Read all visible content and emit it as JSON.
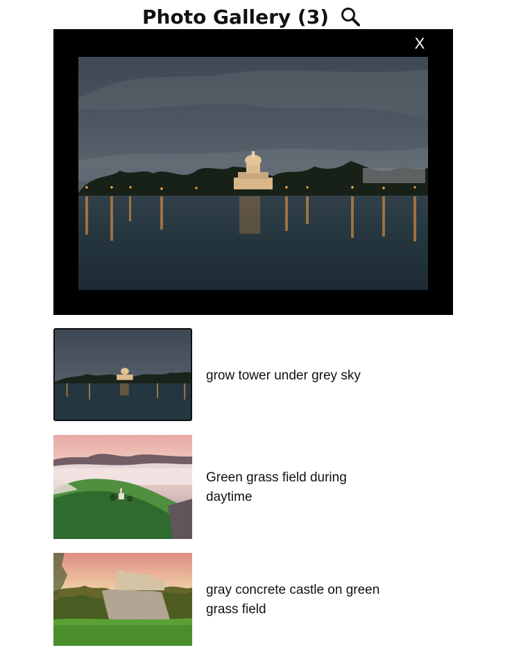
{
  "header": {
    "title": "Photo Gallery (3)",
    "search_icon": "search-icon"
  },
  "viewer": {
    "close_label": "X",
    "image_description": "grow tower under grey sky"
  },
  "gallery": {
    "items": [
      {
        "caption": "grow tower under grey sky",
        "selected": true
      },
      {
        "caption": "Green grass field during daytime",
        "selected": false
      },
      {
        "caption": "gray concrete castle on green grass field",
        "selected": false
      }
    ]
  },
  "colors": {
    "viewer_background": "#000000",
    "page_background": "#ffffff",
    "text": "#111111",
    "close_text": "#ffffff"
  }
}
